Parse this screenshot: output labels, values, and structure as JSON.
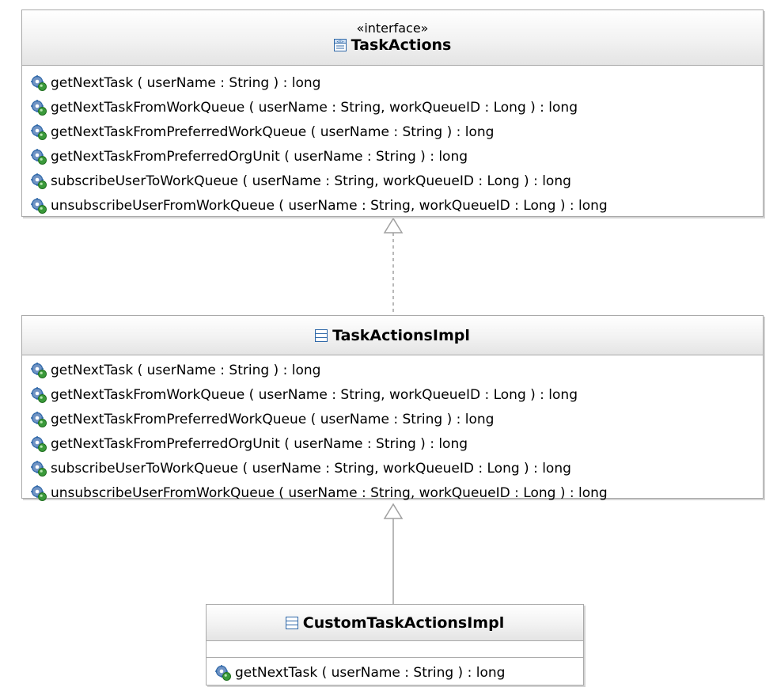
{
  "classes": {
    "interface": {
      "stereotype": "«interface»",
      "name": "TaskActions",
      "icon": "interface-icon",
      "operations": [
        "getNextTask ( userName : String ) : long",
        "getNextTaskFromWorkQueue ( userName : String, workQueueID : Long ) : long",
        "getNextTaskFromPreferredWorkQueue ( userName : String ) : long",
        "getNextTaskFromPreferredOrgUnit ( userName : String ) : long",
        "subscribeUserToWorkQueue ( userName : String, workQueueID : Long ) : long",
        "unsubscribeUserFromWorkQueue ( userName : String, workQueueID : Long ) : long"
      ]
    },
    "impl": {
      "name": "TaskActionsImpl",
      "icon": "class-icon",
      "operations": [
        "getNextTask ( userName : String ) : long",
        "getNextTaskFromWorkQueue ( userName : String, workQueueID : Long ) : long",
        "getNextTaskFromPreferredWorkQueue ( userName : String ) : long",
        "getNextTaskFromPreferredOrgUnit ( userName : String ) : long",
        "subscribeUserToWorkQueue ( userName : String, workQueueID : Long ) : long",
        "unsubscribeUserFromWorkQueue ( userName : String, workQueueID : Long ) : long"
      ]
    },
    "custom": {
      "name": "CustomTaskActionsImpl",
      "icon": "class-icon",
      "operations": [
        "getNextTask ( userName : String ) : long"
      ]
    }
  },
  "relations": [
    {
      "from": "TaskActionsImpl",
      "to": "TaskActions",
      "kind": "realization",
      "line": "dashed"
    },
    {
      "from": "CustomTaskActionsImpl",
      "to": "TaskActionsImpl",
      "kind": "generalization",
      "line": "solid"
    }
  ],
  "colors": {
    "border": "#a9a9a9",
    "connector": "#a0a0a0",
    "icon_blue": "#2f68a8",
    "icon_green": "#3a9a3a"
  }
}
